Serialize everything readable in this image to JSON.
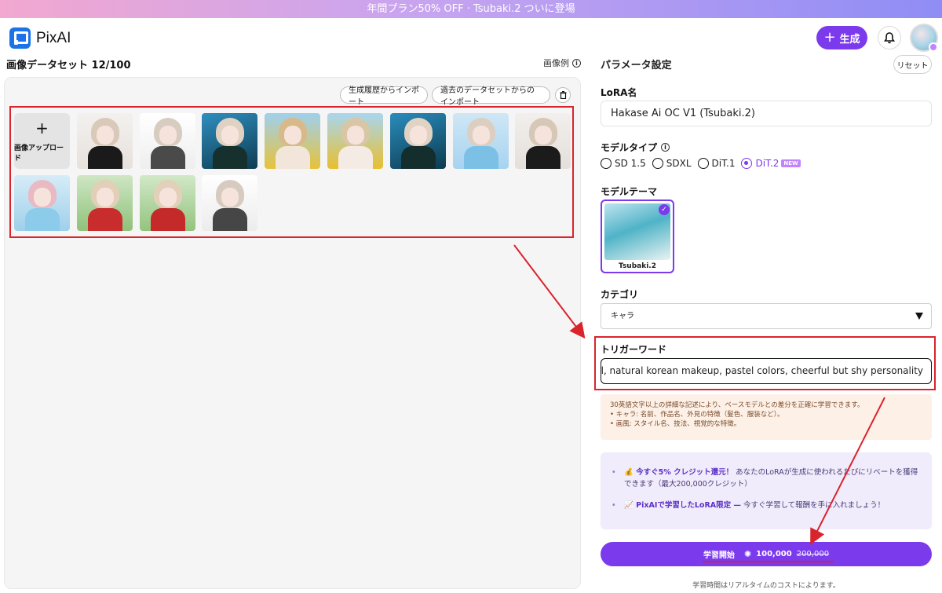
{
  "banner": {
    "text": "年間プラン50% OFF · Tsubaki.2 ついに登場"
  },
  "header": {
    "logo_text": "PixAI",
    "generate_label": "生成",
    "icons": {
      "bell": "bell-icon",
      "avatar": "user-avatar"
    }
  },
  "dataset": {
    "title": "画像データセット 12/100",
    "example_label": "画像例",
    "import_history_label": "生成履歴からインポート",
    "import_dataset_label": "過去のデータセットからのインポート",
    "upload_label": "画像アップロード",
    "image_count": 12
  },
  "params": {
    "title": "パラメータ設定",
    "reset_label": "リセット",
    "lora_name_label": "LoRA名",
    "lora_name_value": "Hakase Ai OC V1 (Tsubaki.2)",
    "model_type_label": "モデルタイプ",
    "model_types": [
      "SD 1.5",
      "SDXL",
      "DiT.1",
      "DiT.2"
    ],
    "model_type_selected": "DiT.2",
    "new_badge": "NEW",
    "model_theme_label": "モデルテーマ",
    "theme_name": "Tsubaki.2",
    "category_label": "カテゴリ",
    "category_value": "キャラ",
    "trigger_label": "トリガーワード",
    "trigger_value": "l, natural korean makeup, pastel colors, cheerful but shy personality",
    "hint_line1": "30英語文字以上の詳細な記述により、ベースモデルとの差分を正確に学習できます。",
    "hint_line2": "• キャラ: 名前、作品名、外見の特徴（髪色、服装など）。",
    "hint_line3": "• 画風: スタイル名、技法、視覚的な特徴。",
    "promo1_bold": "💰 今すぐ5% クレジット還元！",
    "promo1_text": " あなたのLoRAが生成に使われるたびにリベートを獲得できます（最大200,000クレジット）",
    "promo2_bold": "📈 PixAIで学習したLoRA限定 —",
    "promo2_text": " 今すぐ学習して報酬を手に入れましょう！",
    "start_label": "学習開始",
    "cost_value": "100,000",
    "cost_original": "200,000",
    "footnote": "学習時間はリアルタイムのコストによります。"
  },
  "colors": {
    "accent": "#7c3aed",
    "highlight": "#d9232d"
  }
}
